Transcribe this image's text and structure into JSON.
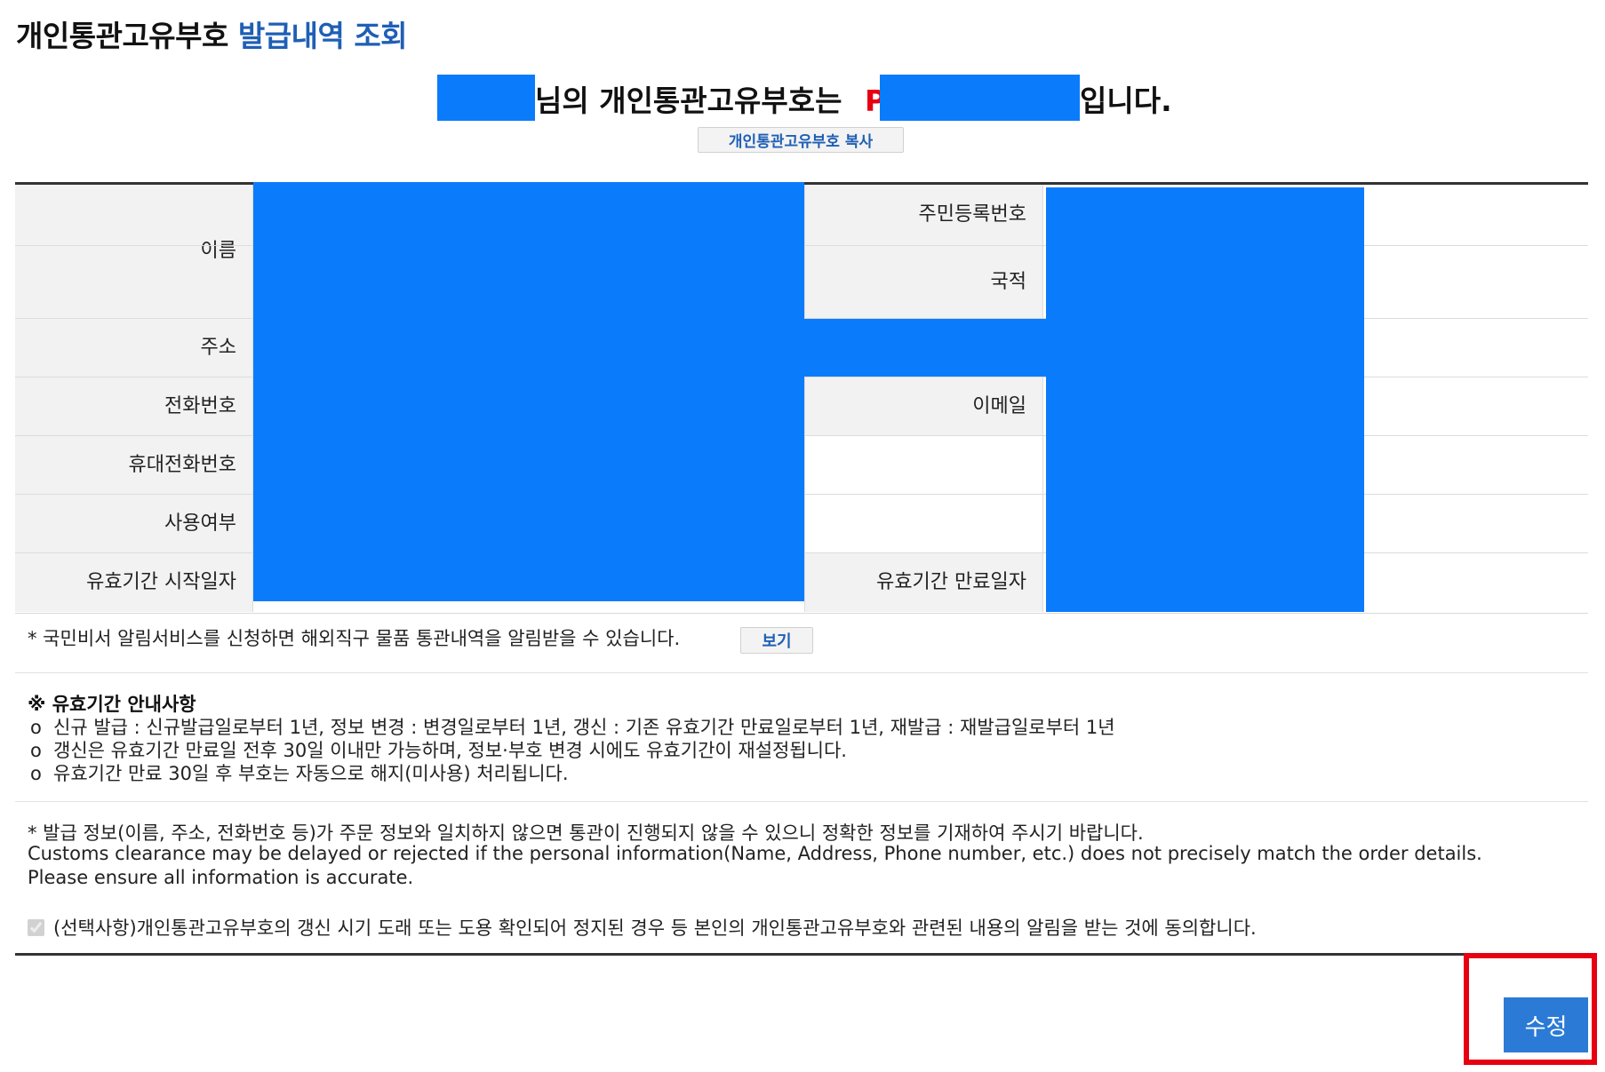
{
  "header": {
    "title_main": "개인통관고유부호",
    "title_accent": "발급내역 조회"
  },
  "notice": {
    "text_mid": "님의 개인통관고유부호는",
    "code_prefix": "P",
    "text_end": "입니다."
  },
  "copy_button": "개인통관고유부호 복사",
  "table": {
    "name": "이름",
    "resident_no": "주민등록번호",
    "nationality": "국적",
    "address": "주소",
    "phone": "전화번호",
    "email": "이메일",
    "mobile": "휴대전화번호",
    "usage": "사용여부",
    "valid_start": "유효기간 시작일자",
    "valid_end": "유효기간 만료일자"
  },
  "notify": {
    "text": "* 국민비서 알림서비스를 신청하면 해외직구 물품 통관내역을 알림받을 수 있습니다.",
    "view_button": "보기"
  },
  "guide": {
    "title": "※ 유효기간 안내사항",
    "bullet": "o",
    "items": [
      "신규 발급 : 신규발급일로부터 1년, 정보 변경 : 변경일로부터 1년, 갱신 : 기존 유효기간 만료일로부터 1년, 재발급 : 재발급일로부터 1년",
      "갱신은 유효기간 만료일 전후 30일 이내만 가능하며, 정보·부호 변경 시에도 유효기간이 재설정됩니다.",
      "유효기간 만료 30일 후 부호는 자동으로 해지(미사용) 처리됩니다."
    ]
  },
  "warning": {
    "ko": "* 발급 정보(이름, 주소, 전화번호 등)가 주문 정보와 일치하지 않으면 통관이 진행되지 않을 수 있으니 정확한 정보를 기재하여 주시기 바랍니다.",
    "en1": "Customs clearance may be delayed or rejected if the personal information(Name, Address, Phone number, etc.) does not precisely match the order details.",
    "en2": "Please ensure all information is accurate."
  },
  "consent": {
    "text": "(선택사항)개인통관고유부호의 갱신 시기 도래 또는 도용 확인되어 정지된 경우 등 본인의 개인통관고유부호와 관련된 내용의 알림을 받는 것에 동의합니다.",
    "checked": true
  },
  "edit_button": "수정",
  "colors": {
    "accent_blue": "#1f5fb5",
    "redaction": "#0a7cfb",
    "highlight_red": "#e60012",
    "button_blue": "#2b7bd6"
  }
}
